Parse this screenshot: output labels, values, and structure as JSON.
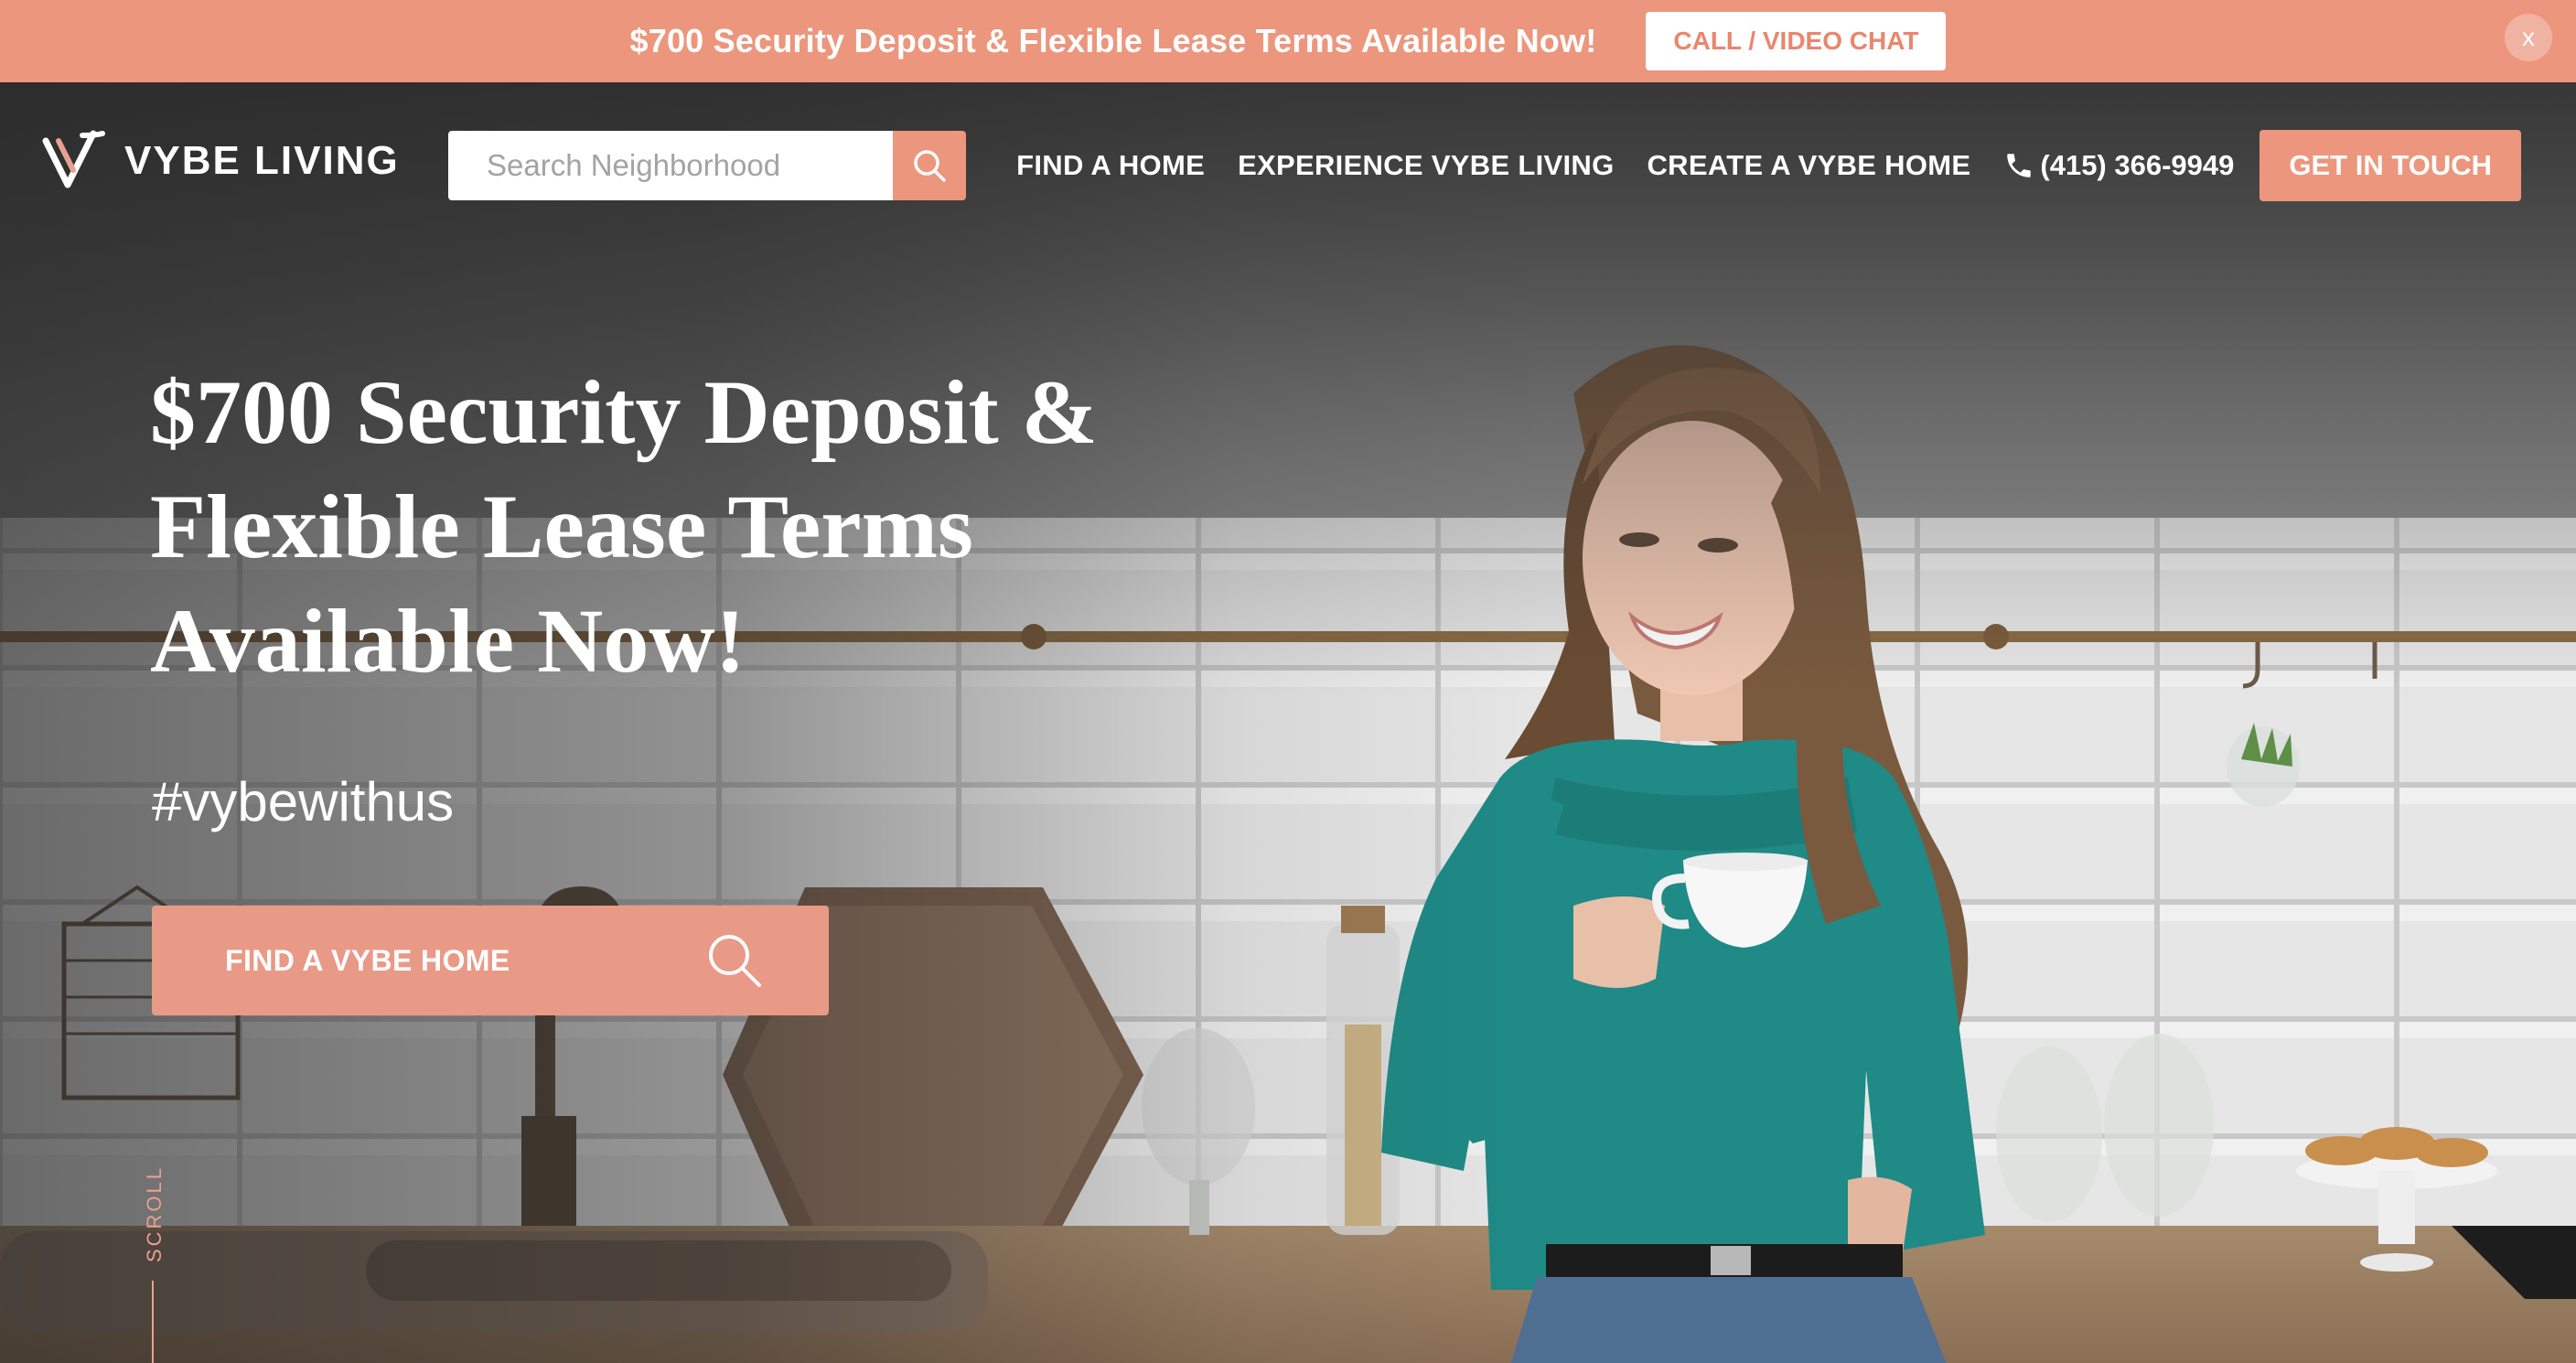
{
  "banner": {
    "text": "$700 Security Deposit & Flexible Lease Terms Available Now!",
    "cta_label": "CALL / VIDEO CHAT",
    "close_label": "x"
  },
  "nav": {
    "logo_text": "VYBE LIVING",
    "search_placeholder": "Search Neighborhood",
    "links": [
      "FIND A HOME",
      "EXPERIENCE VYBE LIVING",
      "CREATE A VYBE HOME"
    ],
    "phone": "(415) 366-9949",
    "cta_label": "GET IN TOUCH"
  },
  "hero": {
    "title_lines": [
      "$700 Security Deposit &",
      "Flexible Lease Terms",
      "Available Now!"
    ],
    "hashtag": "#vybewithus",
    "cta_label": "FIND A VYBE HOME",
    "scroll_label": "SCROLL"
  },
  "icons": {
    "logo": "vybe-logo-icon",
    "search": "search-icon",
    "phone": "phone-icon",
    "close": "close-icon"
  },
  "colors": {
    "accent": "#ec967d",
    "cta_soft": "#e89a87",
    "text_on_dark": "#ffffff",
    "sweater": "#1f8a86"
  }
}
